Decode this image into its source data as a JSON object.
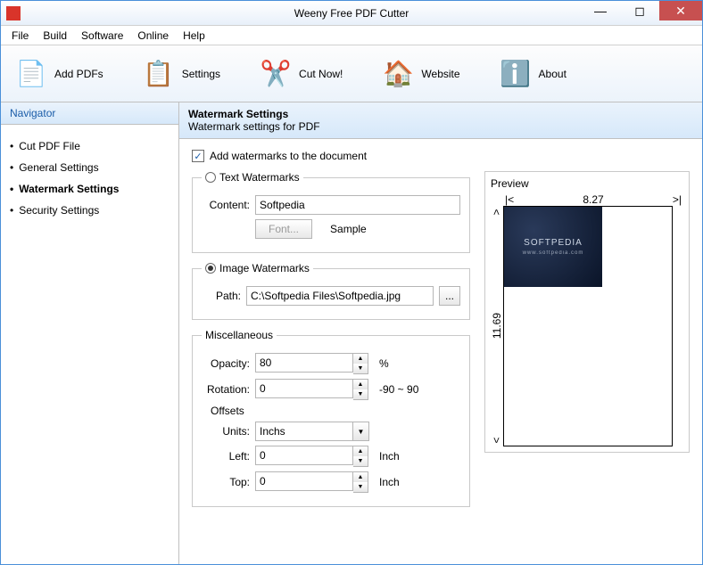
{
  "window": {
    "title": "Weeny Free PDF Cutter"
  },
  "menu": {
    "file": "File",
    "build": "Build",
    "software": "Software",
    "online": "Online",
    "help": "Help"
  },
  "toolbar": {
    "add": "Add PDFs",
    "settings": "Settings",
    "cut": "Cut Now!",
    "website": "Website",
    "about": "About"
  },
  "nav": {
    "header": "Navigator",
    "items": [
      "Cut PDF File",
      "General Settings",
      "Watermark Settings",
      "Security Settings"
    ]
  },
  "panel": {
    "title": "Watermark Settings",
    "subtitle": "Watermark settings for PDF"
  },
  "wm": {
    "enable_label": "Add watermarks to the document",
    "text_group": "Text Watermarks",
    "content_label": "Content:",
    "content_value": "Softpedia",
    "font_btn": "Font...",
    "sample": "Sample",
    "image_group": "Image Watermarks",
    "path_label": "Path:",
    "path_value": "C:\\Softpedia Files\\Softpedia.jpg",
    "browse": "..."
  },
  "misc": {
    "group": "Miscellaneous",
    "opacity_label": "Opacity:",
    "opacity_value": "80",
    "opacity_suffix": "%",
    "rotation_label": "Rotation:",
    "rotation_value": "0",
    "rotation_suffix": "-90 ~ 90",
    "offsets_label": "Offsets",
    "units_label": "Units:",
    "units_value": "Inchs",
    "left_label": "Left:",
    "left_value": "0",
    "top_label": "Top:",
    "top_value": "0",
    "inch_suffix": "Inch"
  },
  "preview": {
    "title": "Preview",
    "width": "8.27",
    "height": "11.69",
    "wm_brand": "SOFTPEDIA",
    "wm_sub": "www.softpedia.com"
  }
}
